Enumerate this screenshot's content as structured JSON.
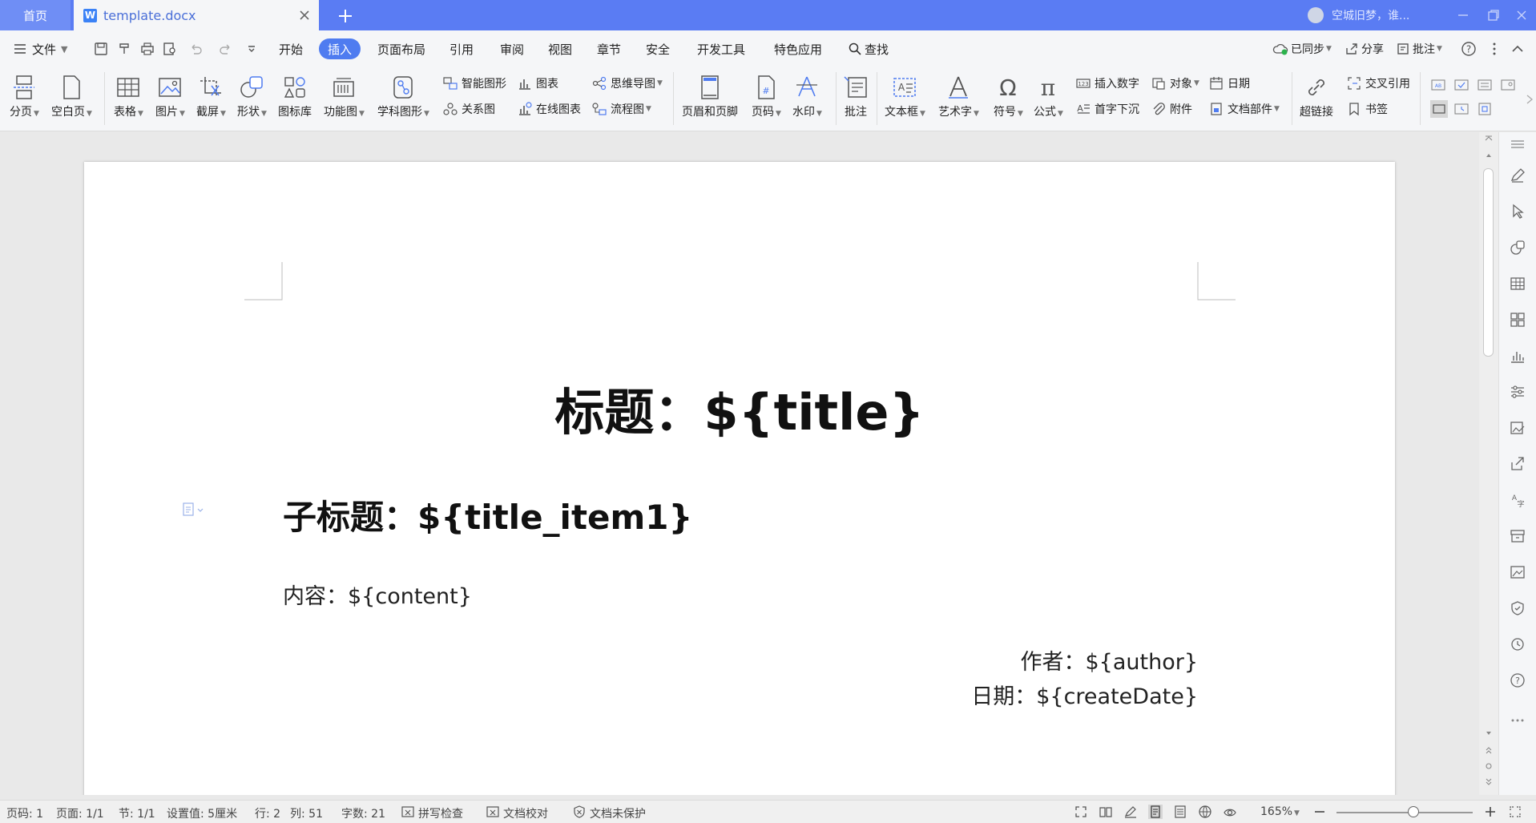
{
  "titlebar": {
    "home_tab": "首页",
    "doc_tab": "template.docx",
    "account_name": "空城旧梦，谁...",
    "accent": "#5a7cf3"
  },
  "menubar": {
    "file": "文件",
    "items": [
      "开始",
      "插入",
      "页面布局",
      "引用",
      "审阅",
      "视图",
      "章节",
      "安全",
      "开发工具",
      "特色应用",
      "查找"
    ],
    "active": "插入",
    "sync": "已同步",
    "share": "分享",
    "comment": "批注"
  },
  "ribbon": {
    "page_break": "分页",
    "blank_page": "空白页",
    "table": "表格",
    "picture": "图片",
    "screenshot": "截屏",
    "shape": "形状",
    "icon_lib": "图标库",
    "func_chart": "功能图",
    "science_shape": "学科图形",
    "smart_shape": "智能图形",
    "chart": "图表",
    "mind_map": "思维导图",
    "relation": "关系图",
    "online_chart": "在线图表",
    "flowchart": "流程图",
    "header_footer": "页眉和页脚",
    "page_num": "页码",
    "watermark": "水印",
    "annotation": "批注",
    "textbox": "文本框",
    "art_text": "艺术字",
    "symbol": "符号",
    "formula": "公式",
    "insert_number": "插入数字",
    "object": "对象",
    "date": "日期",
    "dropcap": "首字下沉",
    "attachment": "附件",
    "doc_part": "文档部件",
    "hyperlink": "超链接",
    "cross_ref": "交叉引用",
    "bookmark": "书签"
  },
  "document": {
    "title": "标题：${title}",
    "subtitle": "子标题：${title_item1}",
    "content": "内容：${content}",
    "author": "作者：${author}",
    "date": "日期：${createDate}"
  },
  "status": {
    "page_code": "页码: 1",
    "page": "页面: 1/1",
    "section": "节: 1/1",
    "setting": "设置值: 5厘米",
    "row": "行: 2",
    "col": "列: 51",
    "words": "字数: 21",
    "spell": "拼写检查",
    "proof": "文档校对",
    "protect": "文档未保护",
    "zoom": "165%"
  }
}
